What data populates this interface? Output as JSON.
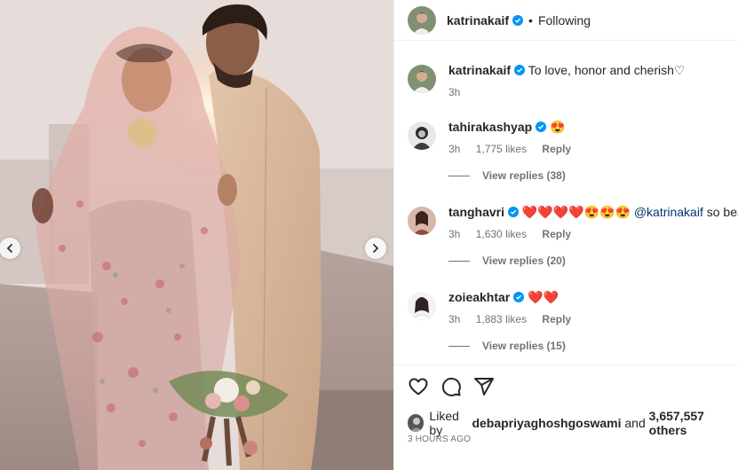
{
  "header": {
    "username": "katrinakaif",
    "separator": "•",
    "follow_status": "Following"
  },
  "caption": {
    "username": "katrinakaif",
    "text": "To love, honor and cherish♡",
    "time": "3h"
  },
  "comments": [
    {
      "username": "tahirakashyap",
      "text": "😍",
      "time": "3h",
      "likes": "1,775 likes",
      "reply_label": "Reply",
      "view_replies": "View replies (38)"
    },
    {
      "username": "tanghavri",
      "text": "❤️❤️❤️❤️😍😍😍",
      "mention": "@katrinakaif",
      "text_after": " so beautiful",
      "time": "3h",
      "likes": "1,630 likes",
      "reply_label": "Reply",
      "view_replies": "View replies (20)"
    },
    {
      "username": "zoieakhtar",
      "text": "❤️❤️",
      "time": "3h",
      "likes": "1,883 likes",
      "reply_label": "Reply",
      "view_replies": "View replies (15)"
    }
  ],
  "likes_summary": {
    "prefix": "Liked by ",
    "user": "debapriyaghoshgoswami",
    "middle": " and ",
    "count": "3,657,557 others"
  },
  "post_time": "3 HOURS AGO",
  "icons": {
    "like": "heart-icon",
    "comment": "comment-icon",
    "share": "share-icon",
    "prev": "chevron-left-icon",
    "next": "chevron-right-icon",
    "verified": "verified-badge-icon"
  },
  "colors": {
    "verified": "#0095f6",
    "secondary_text": "#737373",
    "mention": "#00376b"
  }
}
